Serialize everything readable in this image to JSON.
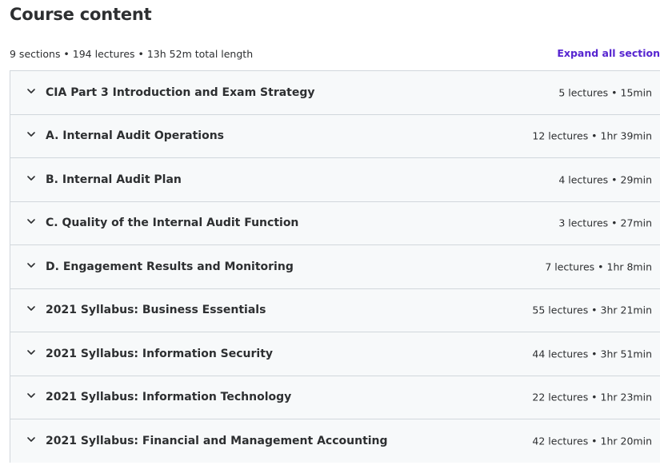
{
  "header": {
    "title": "Course content",
    "summary": "9 sections • 194 lectures • 13h 52m total length",
    "expand_all_label": "Expand all section"
  },
  "colors": {
    "accent": "#5624d0",
    "section_bg": "#f7f9fa",
    "border": "#d1d7dc",
    "text": "#2d2f31"
  },
  "sections": [
    {
      "title": "CIA Part 3 Introduction and Exam Strategy",
      "meta": "5 lectures • 15min",
      "icon": "chevron-down-icon"
    },
    {
      "title": "A. Internal Audit Operations",
      "meta": "12 lectures • 1hr 39min",
      "icon": "chevron-down-icon"
    },
    {
      "title": "B. Internal Audit Plan",
      "meta": "4 lectures • 29min",
      "icon": "chevron-down-icon"
    },
    {
      "title": "C. Quality of the Internal Audit Function",
      "meta": "3 lectures • 27min",
      "icon": "chevron-down-icon"
    },
    {
      "title": "D. Engagement Results and Monitoring",
      "meta": "7 lectures • 1hr 8min",
      "icon": "chevron-down-icon"
    },
    {
      "title": "2021 Syllabus: Business Essentials",
      "meta": "55 lectures • 3hr 21min",
      "icon": "chevron-down-icon"
    },
    {
      "title": "2021 Syllabus: Information Security",
      "meta": "44 lectures • 3hr 51min",
      "icon": "chevron-down-icon"
    },
    {
      "title": "2021 Syllabus: Information Technology",
      "meta": "22 lectures • 1hr 23min",
      "icon": "chevron-down-icon"
    },
    {
      "title": "2021 Syllabus: Financial and Management Accounting",
      "meta": "42 lectures • 1hr 20min",
      "icon": "chevron-down-icon"
    }
  ]
}
